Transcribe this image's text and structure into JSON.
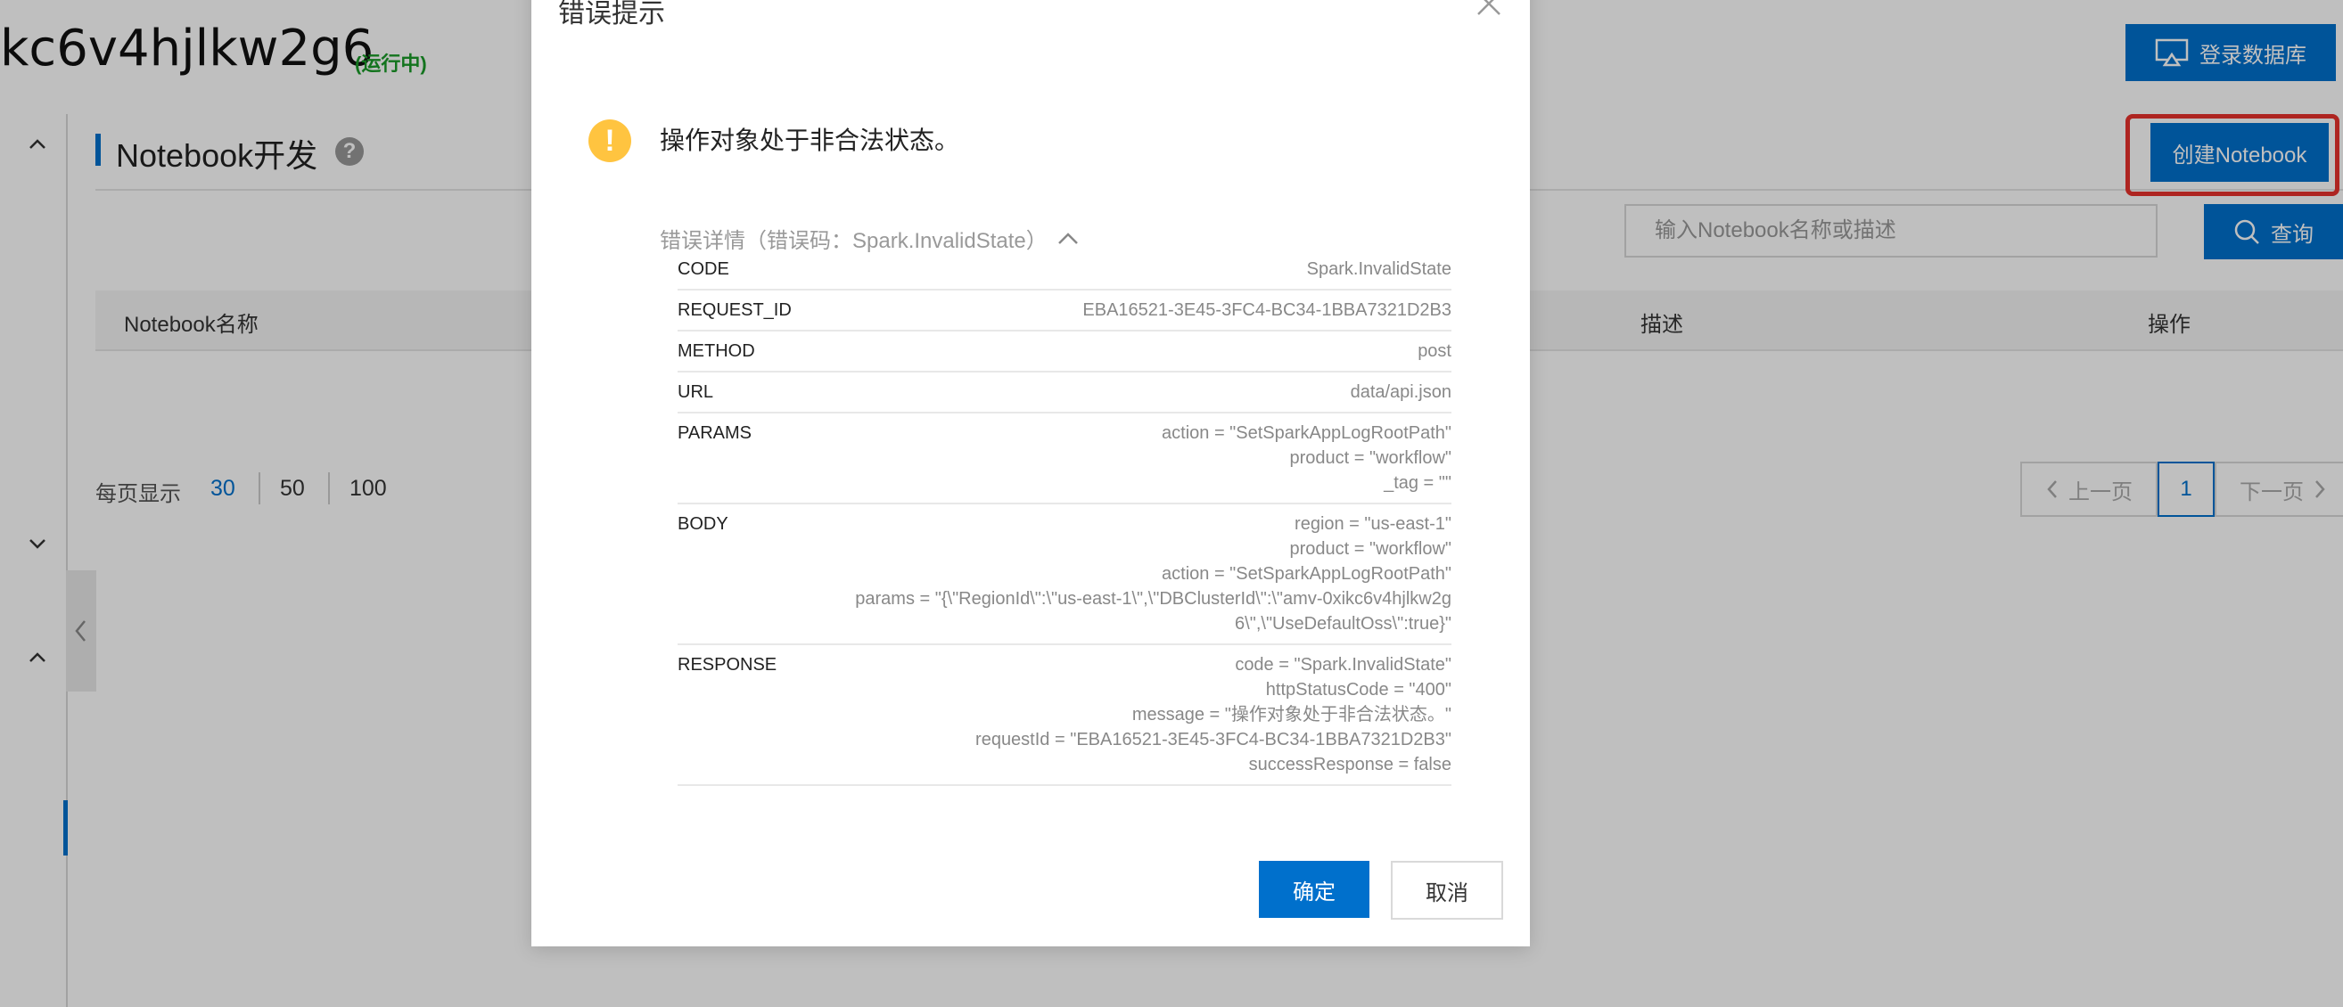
{
  "header": {
    "cluster_title": "kc6v4hjlkw2g6",
    "cluster_status": "(运行中)",
    "login_db_label": "登录数据库"
  },
  "section": {
    "title": "Notebook开发",
    "help": "?",
    "create_label": "创建Notebook"
  },
  "search": {
    "placeholder": "输入Notebook名称或描述",
    "query_label": "查询"
  },
  "table": {
    "columns": [
      "Notebook名称",
      "描述",
      "操作"
    ]
  },
  "pagination": {
    "page_size_label": "每页显示",
    "page_sizes": [
      "30",
      "50",
      "100"
    ],
    "selected_page_size": "30",
    "prev_label": "上一页",
    "current_page": "1",
    "next_label": "下一页"
  },
  "dialog": {
    "title": "错误提示",
    "message": "操作对象处于非合法状态。",
    "details_toggle": "错误详情（错误码：Spark.InvalidState）",
    "details": [
      {
        "key": "CODE",
        "value": "Spark.InvalidState"
      },
      {
        "key": "REQUEST_ID",
        "value": "EBA16521-3E45-3FC4-BC34-1BBA7321D2B3"
      },
      {
        "key": "METHOD",
        "value": "post"
      },
      {
        "key": "URL",
        "value": "data/api.json"
      },
      {
        "key": "PARAMS",
        "value": "action = \"SetSparkAppLogRootPath\"\nproduct = \"workflow\"\n_tag = \"\""
      },
      {
        "key": "BODY",
        "value": "region = \"us-east-1\"\nproduct = \"workflow\"\naction = \"SetSparkAppLogRootPath\"\nparams = \"{\\\"RegionId\\\":\\\"us-east-1\\\",\\\"DBClusterId\\\":\\\"amv-0xikc6v4hjlkw2g\n6\\\",\\\"UseDefaultOss\\\":true}\""
      },
      {
        "key": "RESPONSE",
        "value": "code = \"Spark.InvalidState\"\nhttpStatusCode = \"400\"\nmessage = \"操作对象处于非合法状态。\"\nrequestId = \"EBA16521-3E45-3FC4-BC34-1BBA7321D2B3\"\nsuccessResponse = false"
      }
    ],
    "ok_label": "确定",
    "cancel_label": "取消"
  },
  "colors": {
    "primary": "#0070cc",
    "status_green": "#1a9b28",
    "warning": "#ffc440",
    "highlight_red": "#e8322d"
  }
}
